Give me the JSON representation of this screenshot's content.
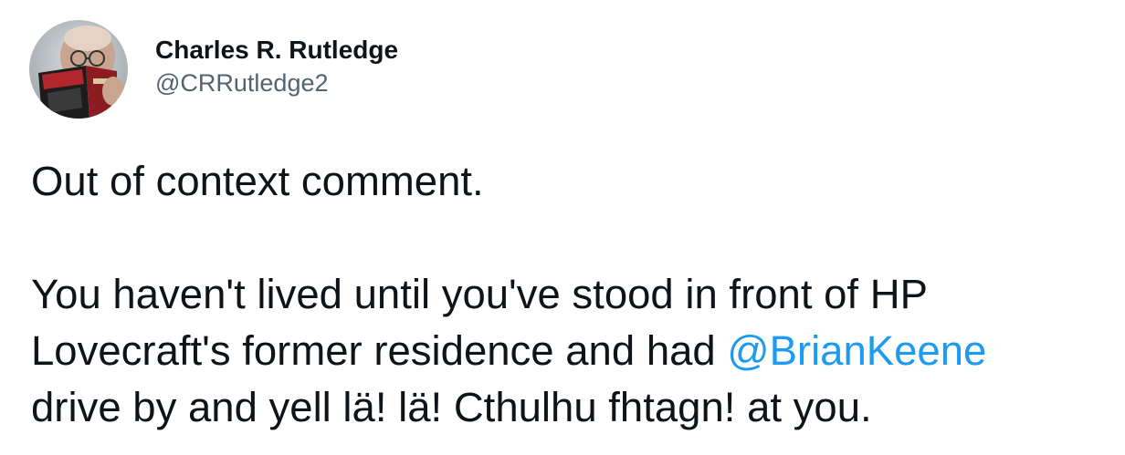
{
  "tweet": {
    "author": {
      "display_name": "Charles R. Rutledge",
      "handle": "@CRRutledge2",
      "avatar_icon": "profile-photo"
    },
    "text": {
      "line1": "Out of context comment.",
      "line2": "You haven't lived until you've stood in front of HP",
      "line3_before": "Lovecraft's former residence and had ",
      "mention": "@BrianKeene",
      "line4": "drive by and yell lä! lä! Cthulhu fhtagn! at you."
    },
    "colors": {
      "text": "#0f1419",
      "secondary": "#536471",
      "link": "#1d9bf0"
    }
  }
}
